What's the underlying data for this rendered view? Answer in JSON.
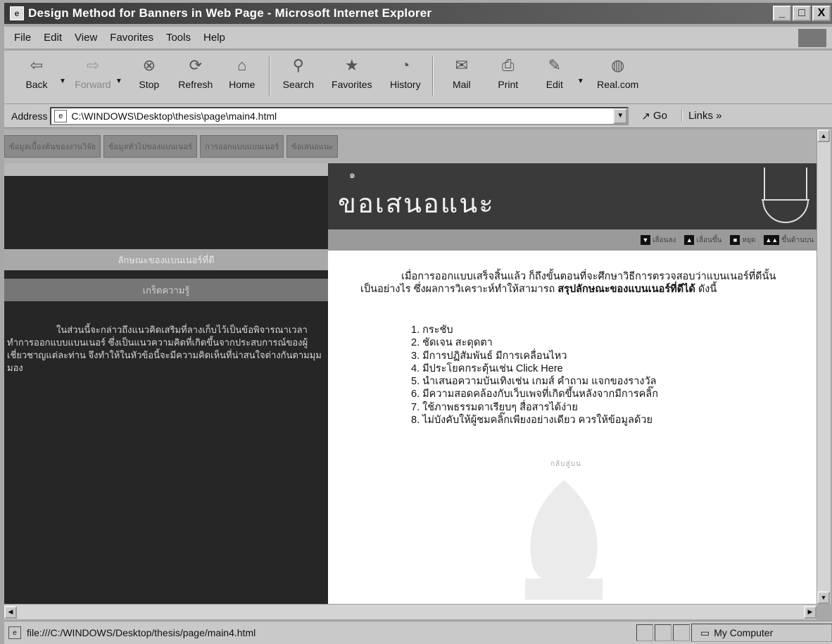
{
  "window": {
    "title": "Design Method for Banners in Web Page - Microsoft Internet Explorer",
    "controls": {
      "minimize": "_",
      "maximize": "□",
      "close": "X"
    }
  },
  "menu": [
    "File",
    "Edit",
    "View",
    "Favorites",
    "Tools",
    "Help"
  ],
  "toolbar": {
    "back": "Back",
    "forward": "Forward",
    "stop": "Stop",
    "refresh": "Refresh",
    "home": "Home",
    "search": "Search",
    "favorites": "Favorites",
    "history": "History",
    "mail": "Mail",
    "print": "Print",
    "edit": "Edit",
    "realcom": "Real.com"
  },
  "address": {
    "label": "Address",
    "value": "C:\\WINDOWS\\Desktop\\thesis\\page\\main4.html",
    "go": "Go",
    "links": "Links »"
  },
  "nav_tabs": [
    "ข้อมูลเบื้องต้นของงานวิจัย",
    "ข้อมูลทั่วไปของแบนเนอร์",
    "การออกแบบแบนเนอร์",
    "ข้อเสนอแนะ"
  ],
  "left": {
    "bar1": "ลักษณะของแบนเนอร์ที่ดี",
    "bar2": "เกร็ดความรู้",
    "text": "ในส่วนนี้จะกล่าวถึงแนวคิดเสริมที่ลางเก็บไว้เป็นข้อพิจารณาเวลาทำการออกแบบแบนเนอร์ ซึ่งเป็นแนวความคิดที่เกิดขึ้นจากประสบการณ์ของผู้เชี่ยวชาญแต่ละท่าน จึงทำให้ในหัวข้อนี้จะมีความคิดเห็นที่น่าสนใจต่างกันตามมุมมอง"
  },
  "header": {
    "mark": "๑",
    "title": "ขอเสนอแนะ"
  },
  "controls": [
    {
      "icon": "▼",
      "label": "เลื่อนลง"
    },
    {
      "icon": "▲",
      "label": "เลื่อนขึ้น"
    },
    {
      "icon": "■",
      "label": "หยุด"
    },
    {
      "icon": "▲▲",
      "label": "ขึ้นด้านบน"
    }
  ],
  "body": {
    "intro_start": "เมื่อการออกแบบเสร็จสิ้นแล้ว ก็ถึงขั้นตอนที่จะศึกษาวิธีการตรวจสอบว่าแบนเนอร์ที่ดีนั้นเป็นอย่างไร ซึ่งผลการวิเคราะห์ทำให้สามารถ ",
    "intro_bold": "สรุปลักษณะของแบนเนอร์ที่ดีได้",
    "intro_end": " ดังนี้",
    "items": [
      "1. กระชับ",
      "2. ชัดเจน สะดุดตา",
      "3. มีการปฏิสัมพันธ์ มีการเคลื่อนไหว",
      "4. มีประโยคกระตุ้นเช่น Click Here",
      "5. นำเสนอความบันเทิงเช่น เกมส์ คำถาม แจกของรางวัล",
      "6. มีความสอดคล้องกับเว็บเพจที่เกิดขึ้นหลังจากมีการคลิ๊ก",
      "7. ใช้ภาพธรรมดาเรียบๆ สื่อสารได้ง่าย",
      "8. ไม่บังคับให้ผู้ชมคลิ๊กเพียงอย่างเดียว ควรให้ข้อมูลด้วย"
    ],
    "faint_note": "กลับสู่บน"
  },
  "status": {
    "text": "file:///C:/WINDOWS/Desktop/thesis/page/main4.html",
    "zone": "My Computer"
  }
}
